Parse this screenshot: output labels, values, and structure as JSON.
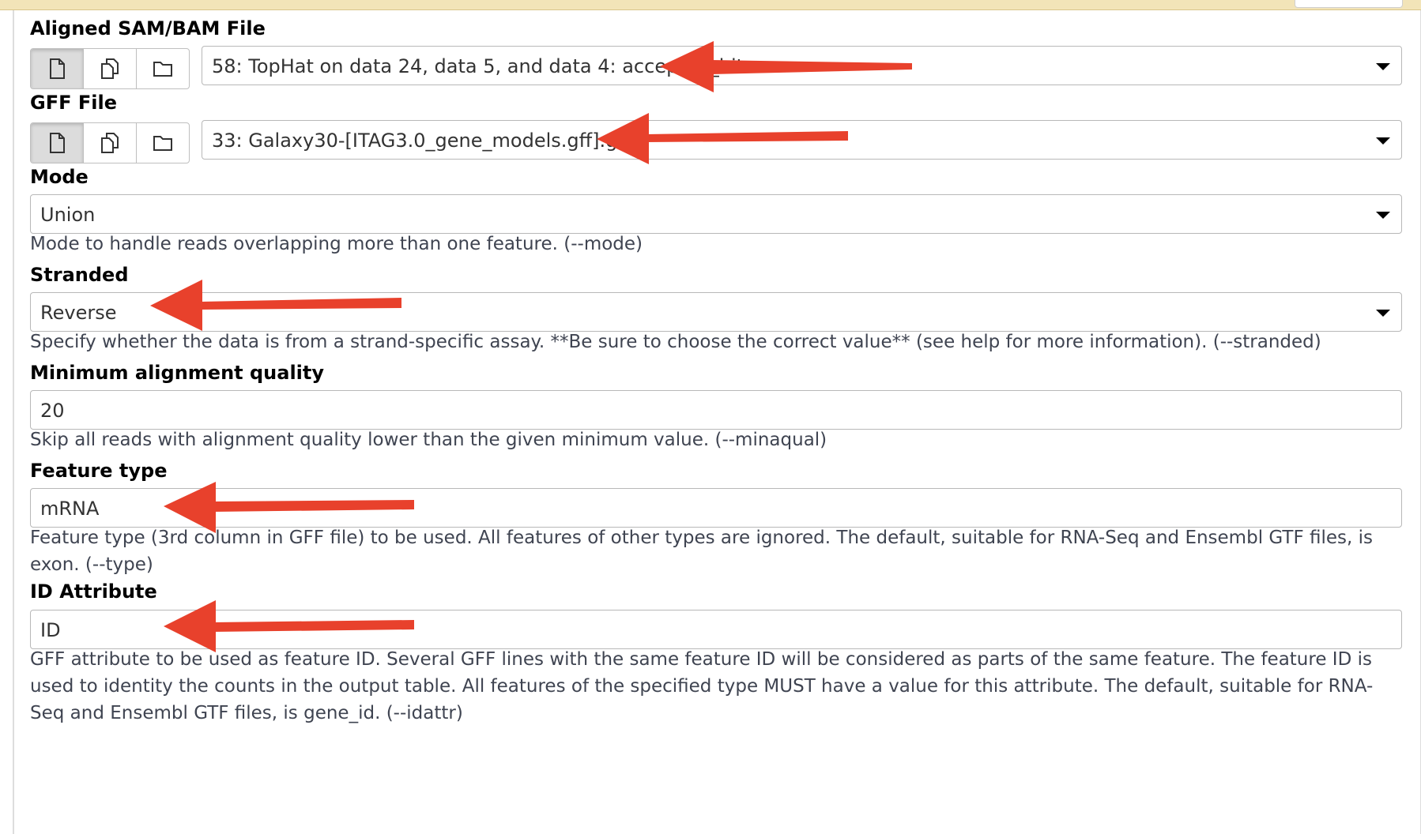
{
  "fields": {
    "bam": {
      "label": "Aligned SAM/BAM File",
      "value": "58: TopHat on data 24, data 5, and data 4: accepted_hits"
    },
    "gff": {
      "label": "GFF File",
      "value": "33: Galaxy30-[ITAG3.0_gene_models.gff].gff3"
    },
    "mode": {
      "label": "Mode",
      "value": "Union",
      "help": "Mode to handle reads overlapping more than one feature. (--mode)"
    },
    "stranded": {
      "label": "Stranded",
      "value": "Reverse",
      "help": "Specify whether the data is from a strand-specific assay. **Be sure to choose the correct value** (see help for more information). (--stranded)"
    },
    "minqual": {
      "label": "Minimum alignment quality",
      "value": "20",
      "help": "Skip all reads with alignment quality lower than the given minimum value. (--minaqual)"
    },
    "feature_type": {
      "label": "Feature type",
      "value": "mRNA",
      "help": "Feature type (3rd column in GFF file) to be used. All features of other types are ignored. The default, suitable for RNA-Seq and Ensembl GTF files, is exon. (--type)"
    },
    "id_attr": {
      "label": "ID Attribute",
      "value": "ID",
      "help": "GFF attribute to be used as feature ID. Several GFF lines with the same feature ID will be considered as parts of the same feature. The feature ID is used to identity the counts in the output table. All features of the specified type MUST have a value for this attribute. The default, suitable for RNA-Seq and Ensembl GTF files, is gene_id. (--idattr)"
    }
  },
  "icons": [
    "single-dataset-icon",
    "multiple-datasets-icon",
    "dataset-collection-icon"
  ],
  "colors": {
    "annotation_arrow": "#e8412c",
    "header_strip": "#f2e4b8"
  }
}
